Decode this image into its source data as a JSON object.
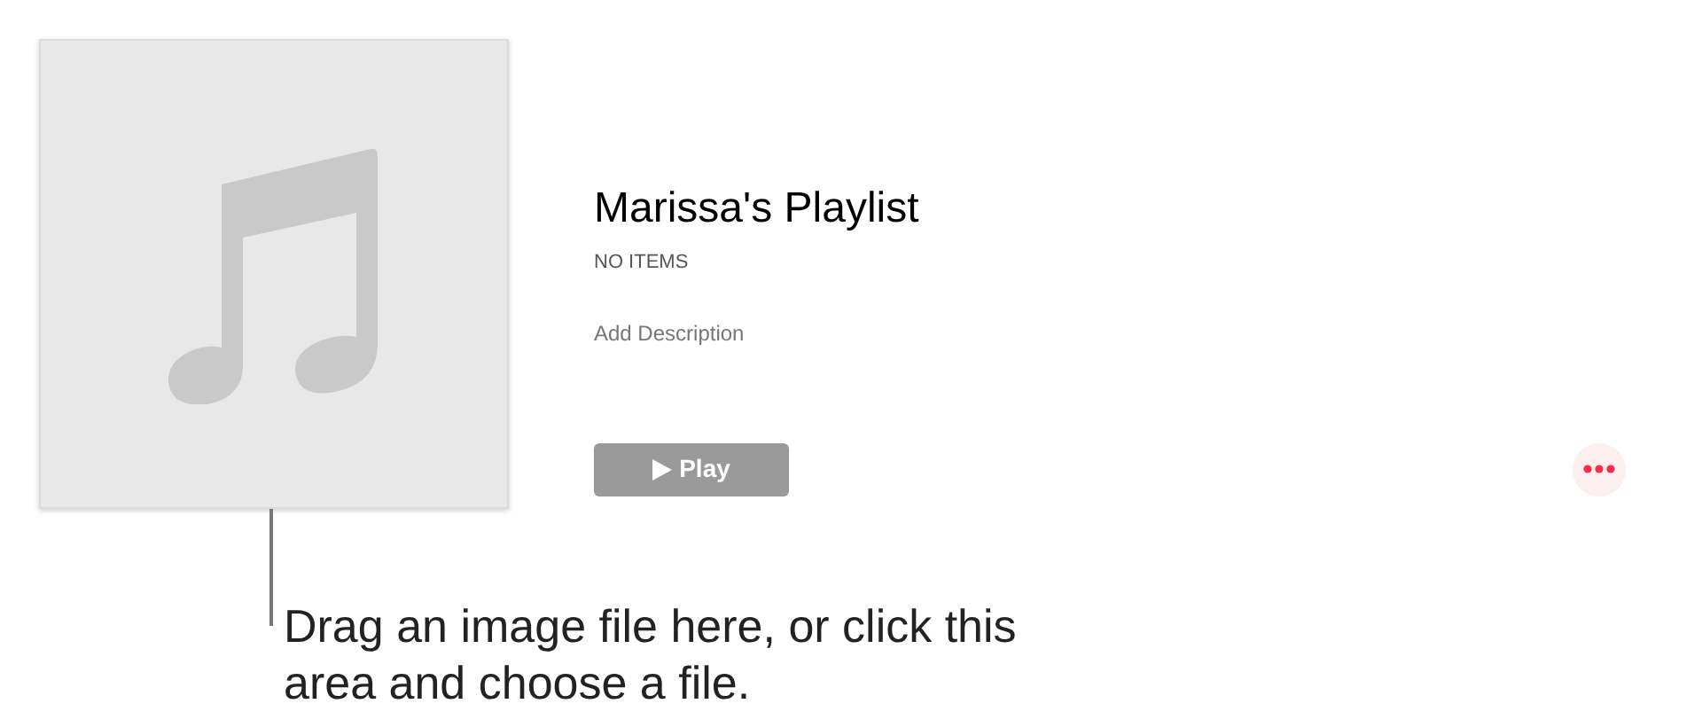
{
  "artwork": {
    "kind": "placeholder"
  },
  "playlist": {
    "title": "Marissa's Playlist",
    "count": "NO ITEMS",
    "description_placeholder": "Add Description"
  },
  "play_button": {
    "label": "Play",
    "disabled": true
  },
  "callout": "Drag an image file here, or click this area and choose a file."
}
